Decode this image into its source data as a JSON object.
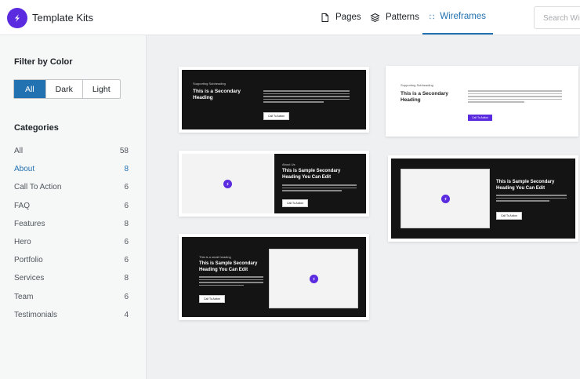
{
  "header": {
    "brand": "Template Kits",
    "tabs": [
      {
        "label": "Pages"
      },
      {
        "label": "Patterns"
      },
      {
        "label": "Wireframes"
      }
    ],
    "search_placeholder": "Search Wireframes",
    "accent": "#2271b1",
    "brand_color": "#5b2be0"
  },
  "sidebar": {
    "filter_title": "Filter by Color",
    "filters": [
      "All",
      "Dark",
      "Light"
    ],
    "categories_title": "Categories",
    "categories": [
      {
        "label": "All",
        "count": "58"
      },
      {
        "label": "About",
        "count": "8"
      },
      {
        "label": "Call To Action",
        "count": "6"
      },
      {
        "label": "FAQ",
        "count": "6"
      },
      {
        "label": "Features",
        "count": "8"
      },
      {
        "label": "Hero",
        "count": "6"
      },
      {
        "label": "Portfolio",
        "count": "6"
      },
      {
        "label": "Services",
        "count": "8"
      },
      {
        "label": "Team",
        "count": "6"
      },
      {
        "label": "Testimonials",
        "count": "4"
      }
    ]
  },
  "cards": {
    "c1": {
      "sub": "Supporting Subheading",
      "heading": "This is a Secondary Heading",
      "btn": "Call To Action"
    },
    "c2": {
      "sub": "Supporting Subheading",
      "heading": "This is a Secondary Heading",
      "btn": "Call To Action"
    },
    "c3": {
      "sub": "About Us",
      "heading": "This is Sample Secondary Heading You Can Edit",
      "btn": "Call To Action"
    },
    "c4": {
      "heading": "This is Sample Secondary Heading You Can Edit",
      "btn": "Call To Action"
    },
    "c5": {
      "sub": "This is a small heading",
      "heading": "This is Sample Secondary Heading You Can Edit",
      "btn": "Call To Action"
    }
  }
}
